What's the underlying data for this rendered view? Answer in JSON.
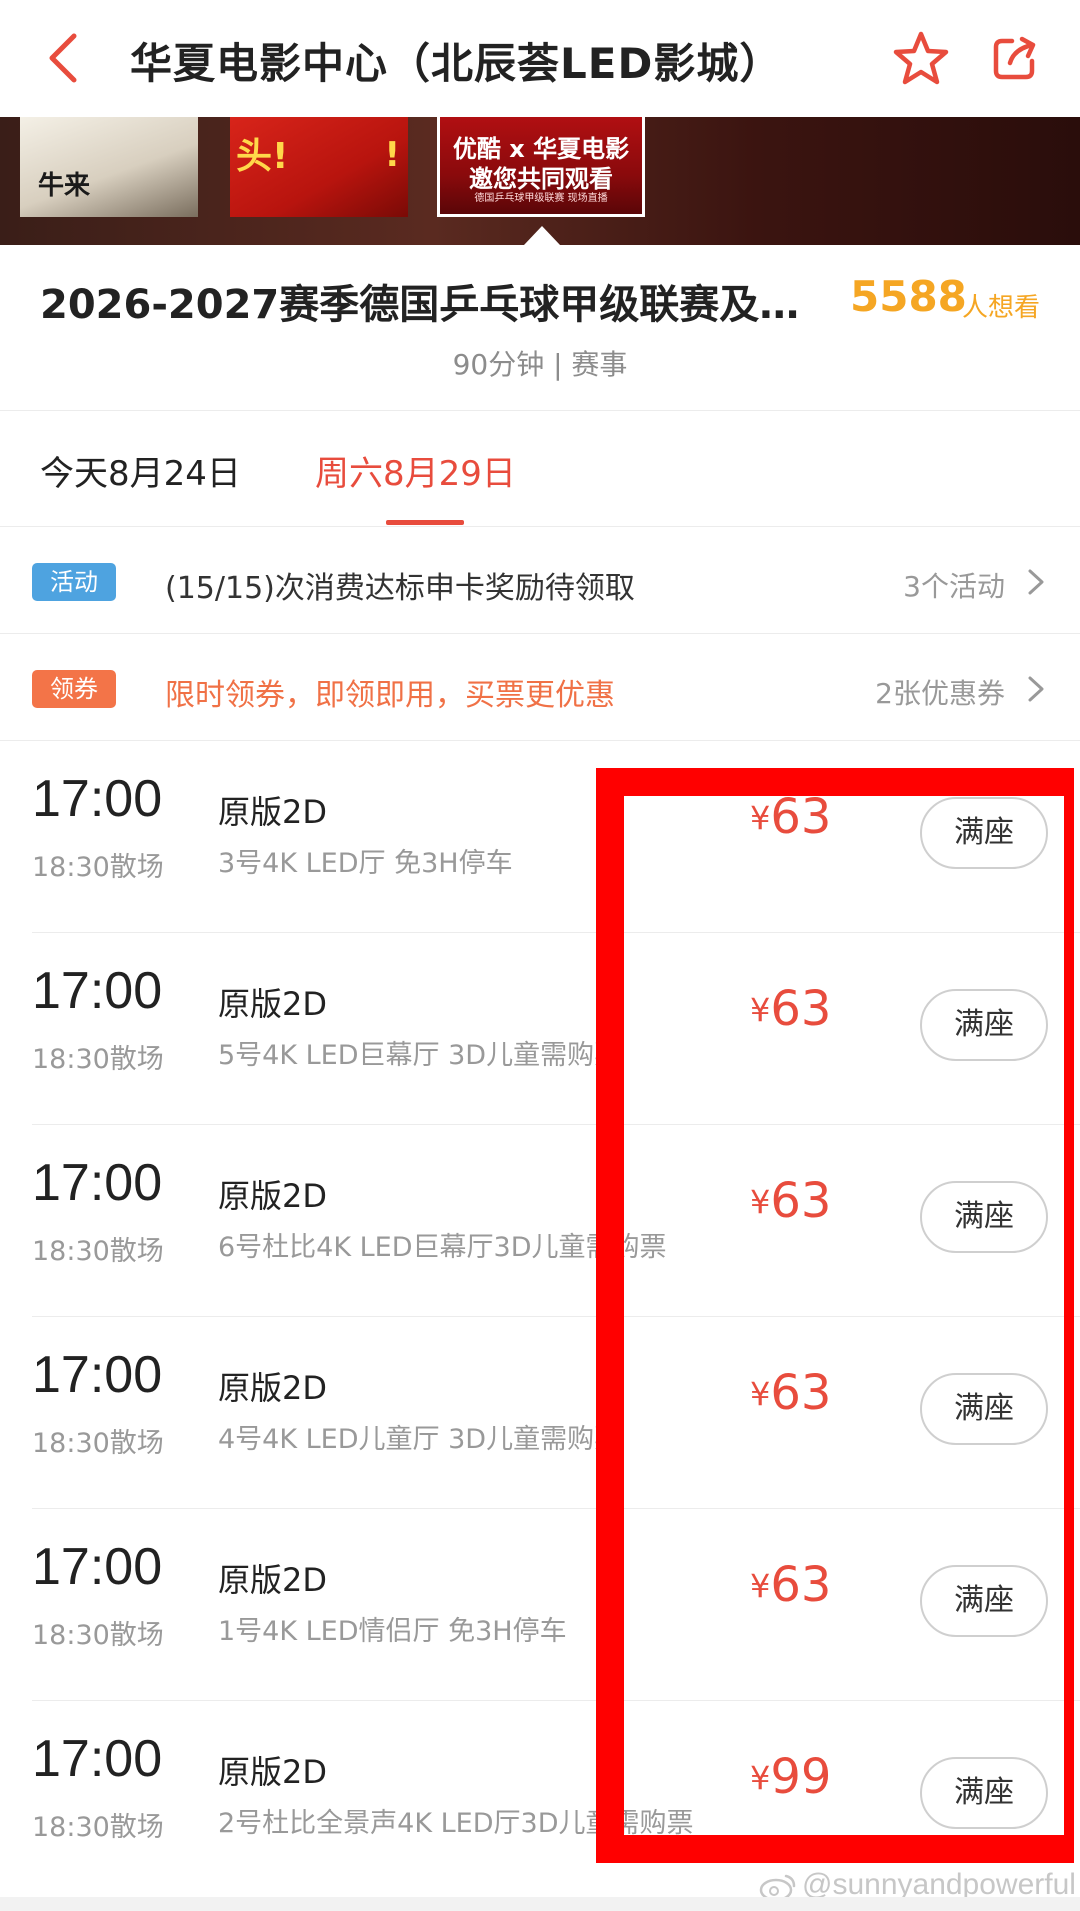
{
  "header": {
    "title": "华夏电影中心（北辰荟LED影城）"
  },
  "posters": [
    {
      "text": "牛来"
    },
    {
      "text_left": "头!",
      "text_right": "!"
    },
    {
      "line1": "优酷 x 华夏电影",
      "line2": "邀您共同观看",
      "line3": "德国乒乓球甲级联赛 现场直播"
    }
  ],
  "movie": {
    "title": "2026-2027赛季德国乒乓球甲级联赛及…",
    "want_count": "5588",
    "want_suffix": "人想看",
    "meta": "90分钟 | 赛事"
  },
  "date_tabs": [
    {
      "label": "今天8月24日",
      "active": false
    },
    {
      "label": "周六8月29日",
      "active": true
    }
  ],
  "promos": [
    {
      "badge": "活动",
      "text": "(15/15)次消费达标申卡奖励待领取",
      "right": "3个活动"
    },
    {
      "badge": "领券",
      "text": "限时领券，即领即用，买票更优惠",
      "right": "2张优惠券"
    }
  ],
  "showtimes": [
    {
      "start": "17:00",
      "end": "18:30散场",
      "format": "原版2D",
      "hall": "3号4K LED厅 免3H停车",
      "currency": "¥",
      "price": "63",
      "button": "满座"
    },
    {
      "start": "17:00",
      "end": "18:30散场",
      "format": "原版2D",
      "hall": "5号4K LED巨幕厅 3D儿童需购票",
      "currency": "¥",
      "price": "63",
      "button": "满座"
    },
    {
      "start": "17:00",
      "end": "18:30散场",
      "format": "原版2D",
      "hall": "6号杜比4K LED巨幕厅3D儿童需购票",
      "currency": "¥",
      "price": "63",
      "button": "满座"
    },
    {
      "start": "17:00",
      "end": "18:30散场",
      "format": "原版2D",
      "hall": "4号4K LED儿童厅 3D儿童需购票",
      "currency": "¥",
      "price": "63",
      "button": "满座"
    },
    {
      "start": "17:00",
      "end": "18:30散场",
      "format": "原版2D",
      "hall": "1号4K LED情侣厅 免3H停车",
      "currency": "¥",
      "price": "63",
      "button": "满座"
    },
    {
      "start": "17:00",
      "end": "18:30散场",
      "format": "原版2D",
      "hall": "2号杜比全景声4K LED厅3D儿童需购票",
      "currency": "¥",
      "price": "99",
      "button": "满座"
    }
  ],
  "watermark": "@sunnyandpowerful",
  "colors": {
    "accent": "#e84c3d",
    "want_orange": "#f5a623",
    "activity_badge": "#4ea3e0",
    "coupon_badge": "#f37448",
    "annotation": "#ff0000"
  }
}
